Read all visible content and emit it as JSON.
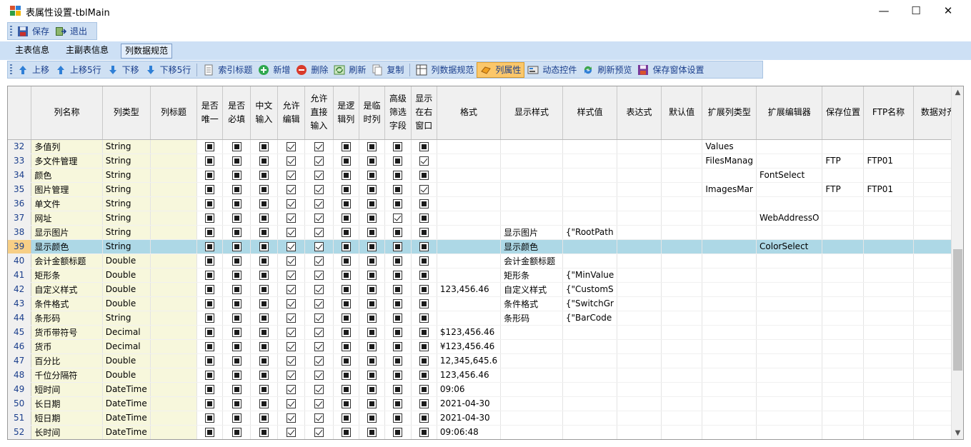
{
  "window": {
    "title": "表属性设置-tblMain",
    "min": "—",
    "max": "☐",
    "close": "✕"
  },
  "toolbar1": [
    {
      "label": "保存",
      "icon": "save-icon"
    },
    {
      "label": "退出",
      "icon": "exit-icon"
    }
  ],
  "tabs": [
    "主表信息",
    "主副表信息",
    "列数据规范"
  ],
  "active_tab": 2,
  "toolbar2": [
    {
      "label": "上移",
      "icon": "arrow-up-icon"
    },
    {
      "label": "上移5行",
      "icon": "arrow-up-5-icon"
    },
    {
      "label": "下移",
      "icon": "arrow-down-icon"
    },
    {
      "label": "下移5行",
      "icon": "arrow-down-5-icon"
    },
    {
      "sep": true
    },
    {
      "label": "索引标题",
      "icon": "document-icon"
    },
    {
      "label": "新增",
      "icon": "add-icon"
    },
    {
      "label": "删除",
      "icon": "delete-icon"
    },
    {
      "label": "刷新",
      "icon": "refresh-icon"
    },
    {
      "label": "复制",
      "icon": "copy-icon"
    },
    {
      "sep": true
    },
    {
      "label": "列数据规范",
      "icon": "grid-spec-icon"
    },
    {
      "label": "列属性",
      "icon": "column-property-icon",
      "highlight": true
    },
    {
      "label": "动态控件",
      "icon": "dynamic-control-icon"
    },
    {
      "label": "刷新预览",
      "icon": "refresh-preview-icon"
    },
    {
      "label": "保存窗体设置",
      "icon": "save-form-icon"
    }
  ],
  "grid": {
    "selected_row": 39,
    "columns": [
      {
        "key": "name",
        "label": "列名称"
      },
      {
        "key": "type",
        "label": "列类型"
      },
      {
        "key": "title",
        "label": "列标题"
      },
      {
        "key": "unique",
        "label": "是否\n唯一"
      },
      {
        "key": "required",
        "label": "是否\n必填"
      },
      {
        "key": "cn_input",
        "label": "中文\n输入"
      },
      {
        "key": "editable",
        "label": "允许\n编辑"
      },
      {
        "key": "direct_input",
        "label": "允许\n直接\n输入"
      },
      {
        "key": "logic",
        "label": "是逻\n辑列"
      },
      {
        "key": "temp",
        "label": "是临\n时列"
      },
      {
        "key": "adv_filter",
        "label": "高级\n筛选\n字段"
      },
      {
        "key": "show_right",
        "label": "显示\n在右\n窗口"
      },
      {
        "key": "format",
        "label": "格式"
      },
      {
        "key": "display_style",
        "label": "显示样式"
      },
      {
        "key": "style_value",
        "label": "样式值"
      },
      {
        "key": "expression",
        "label": "表达式"
      },
      {
        "key": "default",
        "label": "默认值"
      },
      {
        "key": "ext_col_type",
        "label": "扩展列类型"
      },
      {
        "key": "ext_editor",
        "label": "扩展编辑器"
      },
      {
        "key": "save_loc",
        "label": "保存位置"
      },
      {
        "key": "ftp",
        "label": "FTP名称"
      },
      {
        "key": "align",
        "label": "数据对齐"
      }
    ],
    "rows": [
      {
        "n": "32",
        "name": "多值列",
        "type": "String",
        "cb": [
          "i",
          "i",
          "i",
          "c",
          "c",
          "i",
          "i",
          "i",
          "i"
        ],
        "format": "",
        "display_style": "",
        "style_value": "",
        "ext_col_type": "Values",
        "ext_editor": "",
        "save_loc": "",
        "ftp": ""
      },
      {
        "n": "33",
        "name": "多文件管理",
        "type": "String",
        "cb": [
          "i",
          "i",
          "i",
          "c",
          "c",
          "i",
          "i",
          "i",
          "c"
        ],
        "format": "",
        "display_style": "",
        "style_value": "",
        "ext_col_type": "FilesManag",
        "ext_editor": "",
        "save_loc": "FTP",
        "ftp": "FTP01"
      },
      {
        "n": "34",
        "name": "颜色",
        "type": "String",
        "cb": [
          "i",
          "i",
          "i",
          "c",
          "c",
          "i",
          "i",
          "i",
          "i"
        ],
        "format": "",
        "display_style": "",
        "style_value": "",
        "ext_col_type": "",
        "ext_editor": "FontSelect",
        "save_loc": "",
        "ftp": ""
      },
      {
        "n": "35",
        "name": "图片管理",
        "type": "String",
        "cb": [
          "i",
          "i",
          "i",
          "c",
          "c",
          "i",
          "i",
          "i",
          "c"
        ],
        "format": "",
        "display_style": "",
        "style_value": "",
        "ext_col_type": "ImagesMar",
        "ext_editor": "",
        "save_loc": "FTP",
        "ftp": "FTP01"
      },
      {
        "n": "36",
        "name": "单文件",
        "type": "String",
        "cb": [
          "i",
          "i",
          "i",
          "c",
          "c",
          "i",
          "i",
          "i",
          "i"
        ],
        "format": "",
        "display_style": "",
        "style_value": "",
        "ext_col_type": "",
        "ext_editor": "",
        "save_loc": "",
        "ftp": ""
      },
      {
        "n": "37",
        "name": "网址",
        "type": "String",
        "cb": [
          "i",
          "i",
          "i",
          "c",
          "c",
          "i",
          "i",
          "c",
          "i"
        ],
        "format": "",
        "display_style": "",
        "style_value": "",
        "ext_col_type": "",
        "ext_editor": "WebAddressO",
        "save_loc": "",
        "ftp": ""
      },
      {
        "n": "38",
        "name": "显示图片",
        "type": "String",
        "cb": [
          "i",
          "i",
          "i",
          "c",
          "c",
          "i",
          "i",
          "i",
          "i"
        ],
        "format": "",
        "display_style": "显示图片",
        "style_value": "{\"RootPath",
        "ext_col_type": "",
        "ext_editor": "",
        "save_loc": "",
        "ftp": ""
      },
      {
        "n": "39",
        "name": "显示颜色",
        "type": "String",
        "cb": [
          "i",
          "i",
          "i",
          "c",
          "c",
          "i",
          "i",
          "i",
          "i"
        ],
        "format": "",
        "display_style": "显示颜色",
        "style_value": "",
        "ext_col_type": "",
        "ext_editor": "ColorSelect",
        "save_loc": "",
        "ftp": ""
      },
      {
        "n": "40",
        "name": "会计金额标题",
        "type": "Double",
        "cb": [
          "i",
          "i",
          "i",
          "c",
          "c",
          "i",
          "i",
          "i",
          "i"
        ],
        "format": "",
        "display_style": "会计金额标题",
        "style_value": "",
        "ext_col_type": "",
        "ext_editor": "",
        "save_loc": "",
        "ftp": ""
      },
      {
        "n": "41",
        "name": "矩形条",
        "type": "Double",
        "cb": [
          "i",
          "i",
          "i",
          "c",
          "c",
          "i",
          "i",
          "i",
          "i"
        ],
        "format": "",
        "display_style": "矩形条",
        "style_value": "{\"MinValue",
        "ext_col_type": "",
        "ext_editor": "",
        "save_loc": "",
        "ftp": ""
      },
      {
        "n": "42",
        "name": "自定义样式",
        "type": "Double",
        "cb": [
          "i",
          "i",
          "i",
          "c",
          "c",
          "i",
          "i",
          "i",
          "i"
        ],
        "format": "123,456.46",
        "display_style": "自定义样式",
        "style_value": "{\"CustomS",
        "ext_col_type": "",
        "ext_editor": "",
        "save_loc": "",
        "ftp": ""
      },
      {
        "n": "43",
        "name": "条件格式",
        "type": "Double",
        "cb": [
          "i",
          "i",
          "i",
          "c",
          "c",
          "i",
          "i",
          "i",
          "i"
        ],
        "format": "",
        "display_style": "条件格式",
        "style_value": "{\"SwitchGr",
        "ext_col_type": "",
        "ext_editor": "",
        "save_loc": "",
        "ftp": ""
      },
      {
        "n": "44",
        "name": "条形码",
        "type": "String",
        "cb": [
          "i",
          "i",
          "i",
          "c",
          "c",
          "i",
          "i",
          "i",
          "i"
        ],
        "format": "",
        "display_style": "条形码",
        "style_value": "{\"BarCode",
        "ext_col_type": "",
        "ext_editor": "",
        "save_loc": "",
        "ftp": ""
      },
      {
        "n": "45",
        "name": "货币带符号",
        "type": "Decimal",
        "cb": [
          "i",
          "i",
          "i",
          "c",
          "c",
          "i",
          "i",
          "i",
          "i"
        ],
        "format": "$123,456.46",
        "display_style": "",
        "style_value": "",
        "ext_col_type": "",
        "ext_editor": "",
        "save_loc": "",
        "ftp": ""
      },
      {
        "n": "46",
        "name": "货币",
        "type": "Decimal",
        "cb": [
          "i",
          "i",
          "i",
          "c",
          "c",
          "i",
          "i",
          "i",
          "i"
        ],
        "format": "¥123,456.46",
        "display_style": "",
        "style_value": "",
        "ext_col_type": "",
        "ext_editor": "",
        "save_loc": "",
        "ftp": ""
      },
      {
        "n": "47",
        "name": "百分比",
        "type": "Double",
        "cb": [
          "i",
          "i",
          "i",
          "c",
          "c",
          "i",
          "i",
          "i",
          "i"
        ],
        "format": "12,345,645.6",
        "display_style": "",
        "style_value": "",
        "ext_col_type": "",
        "ext_editor": "",
        "save_loc": "",
        "ftp": ""
      },
      {
        "n": "48",
        "name": "千位分隔符",
        "type": "Double",
        "cb": [
          "i",
          "i",
          "i",
          "c",
          "c",
          "i",
          "i",
          "i",
          "i"
        ],
        "format": "123,456.46",
        "display_style": "",
        "style_value": "",
        "ext_col_type": "",
        "ext_editor": "",
        "save_loc": "",
        "ftp": ""
      },
      {
        "n": "49",
        "name": "短时间",
        "type": "DateTime",
        "cb": [
          "i",
          "i",
          "i",
          "c",
          "c",
          "i",
          "i",
          "i",
          "i"
        ],
        "format": "09:06",
        "display_style": "",
        "style_value": "",
        "ext_col_type": "",
        "ext_editor": "",
        "save_loc": "",
        "ftp": ""
      },
      {
        "n": "50",
        "name": "长日期",
        "type": "DateTime",
        "cb": [
          "i",
          "i",
          "i",
          "c",
          "c",
          "i",
          "i",
          "i",
          "i"
        ],
        "format": "2021-04-30",
        "display_style": "",
        "style_value": "",
        "ext_col_type": "",
        "ext_editor": "",
        "save_loc": "",
        "ftp": ""
      },
      {
        "n": "51",
        "name": "短日期",
        "type": "DateTime",
        "cb": [
          "i",
          "i",
          "i",
          "c",
          "c",
          "i",
          "i",
          "i",
          "i"
        ],
        "format": "2021-04-30",
        "display_style": "",
        "style_value": "",
        "ext_col_type": "",
        "ext_editor": "",
        "save_loc": "",
        "ftp": ""
      },
      {
        "n": "52",
        "name": "长时间",
        "type": "DateTime",
        "cb": [
          "i",
          "i",
          "i",
          "c",
          "c",
          "i",
          "i",
          "i",
          "i"
        ],
        "format": "09:06:48",
        "display_style": "",
        "style_value": "",
        "ext_col_type": "",
        "ext_editor": "",
        "save_loc": "",
        "ftp": ""
      }
    ]
  },
  "colors": {
    "tab_band": "#cde0f5",
    "toolbar_bg": "#cfe0f3",
    "selected_row": "#add8e6",
    "name_col_bg": "#f7f7dc",
    "highlight_button": "#fbc76a"
  }
}
